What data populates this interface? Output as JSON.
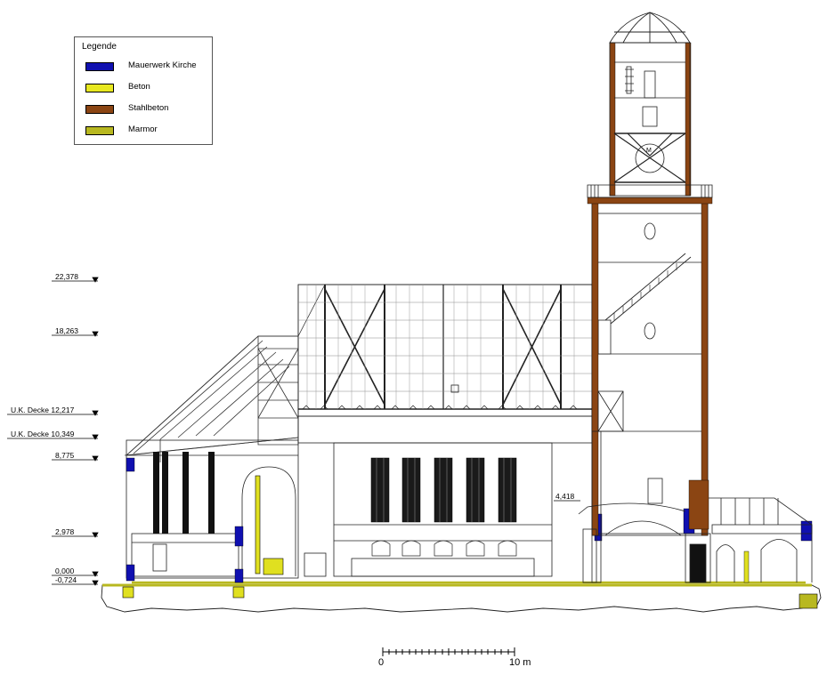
{
  "legend": {
    "title": "Legende",
    "items": [
      {
        "label": "Mauerwerk Kirche",
        "color": "#1010b0"
      },
      {
        "label": "Beton",
        "color": "#e8e820"
      },
      {
        "label": "Stahlbeton",
        "color": "#8b4513"
      },
      {
        "label": "Marmor",
        "color": "#b8b820"
      }
    ]
  },
  "levels": [
    {
      "label": "22,378"
    },
    {
      "label": "18,263"
    },
    {
      "label": "U.K. Decke 12,217"
    },
    {
      "label": "U.K. Decke 10,349"
    },
    {
      "label": "8,775"
    },
    {
      "label": "2,978"
    },
    {
      "label": "0,000"
    },
    {
      "label": "-0,724"
    }
  ],
  "annotation": {
    "label": "4,418"
  },
  "tower_clock_text": "M",
  "scale_bar": {
    "start_label": "0",
    "end_label": "10 m"
  }
}
